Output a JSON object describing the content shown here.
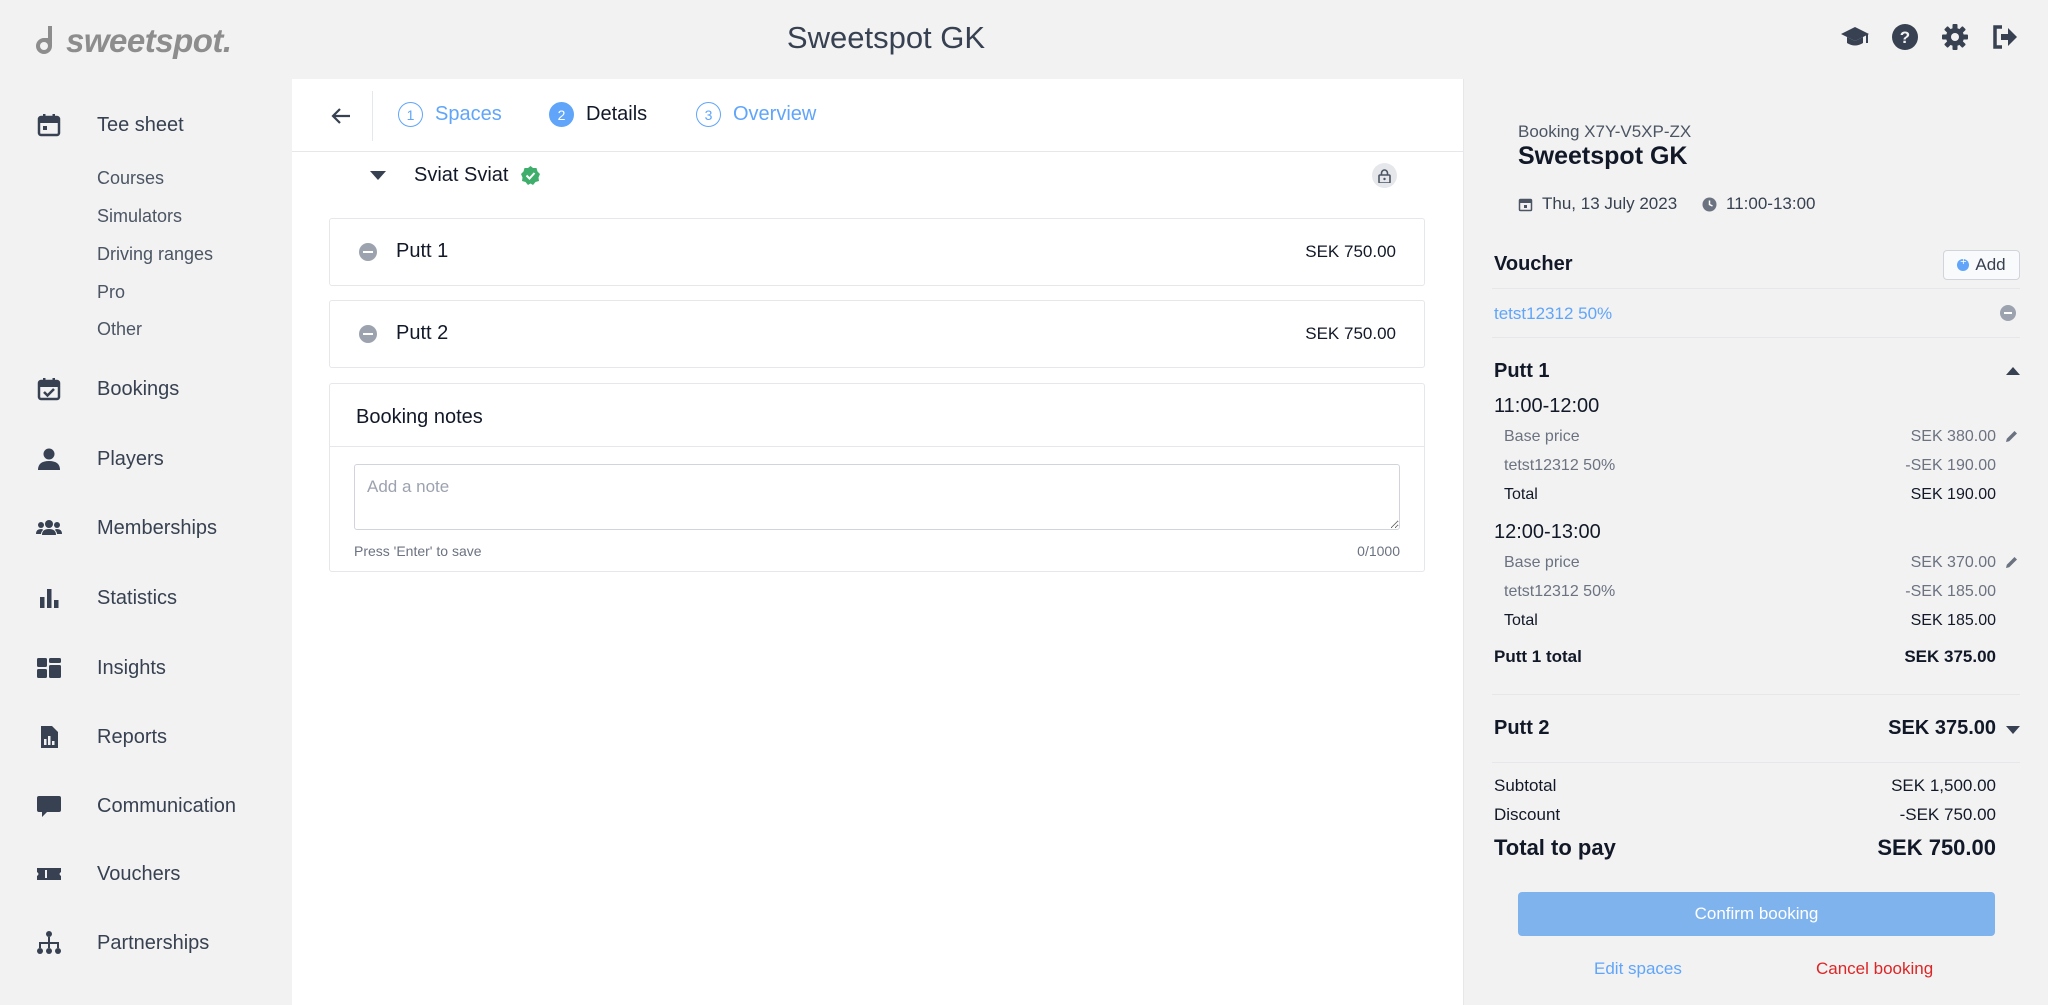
{
  "header": {
    "logo_text": "sweetspot.",
    "title": "Sweetspot GK",
    "icons": [
      "graduation-cap-icon",
      "help-icon",
      "settings-icon",
      "logout-icon"
    ]
  },
  "sidebar": {
    "tee_sheet": "Tee sheet",
    "tee_sheet_sub": [
      "Courses",
      "Simulators",
      "Driving ranges",
      "Pro",
      "Other"
    ],
    "items": [
      "Bookings",
      "Players",
      "Memberships",
      "Statistics",
      "Insights",
      "Reports",
      "Communication",
      "Vouchers",
      "Partnerships"
    ]
  },
  "steps": [
    {
      "num": "1",
      "label": "Spaces"
    },
    {
      "num": "2",
      "label": "Details"
    },
    {
      "num": "3",
      "label": "Overview"
    }
  ],
  "player": {
    "name": "Sviat Sviat"
  },
  "spaces": [
    {
      "name": "Putt 1",
      "price": "SEK 750.00"
    },
    {
      "name": "Putt 2",
      "price": "SEK 750.00"
    }
  ],
  "notes": {
    "title": "Booking notes",
    "placeholder": "Add a note",
    "hint": "Press 'Enter' to save",
    "count": "0/1000"
  },
  "summary": {
    "booking_id": "Booking X7Y-V5XP-ZX",
    "venue": "Sweetspot GK",
    "date": "Thu, 13 July 2023",
    "time": "11:00-13:00",
    "voucher_title": "Voucher",
    "add_label": "Add",
    "voucher_code": "tetst12312 50%",
    "putt1": {
      "title": "Putt 1",
      "slots": [
        {
          "time": "11:00-12:00",
          "base_label": "Base price",
          "base": "SEK 380.00",
          "disc_label": "tetst12312 50%",
          "disc": "-SEK 190.00",
          "total_label": "Total",
          "total": "SEK 190.00"
        },
        {
          "time": "12:00-13:00",
          "base_label": "Base price",
          "base": "SEK 370.00",
          "disc_label": "tetst12312 50%",
          "disc": "-SEK 185.00",
          "total_label": "Total",
          "total": "SEK 185.00"
        }
      ],
      "total_label": "Putt 1 total",
      "total": "SEK 375.00"
    },
    "putt2": {
      "title": "Putt 2",
      "total": "SEK 375.00"
    },
    "subtotal_label": "Subtotal",
    "subtotal": "SEK 1,500.00",
    "discount_label": "Discount",
    "discount": "-SEK 750.00",
    "total_label": "Total to pay",
    "total": "SEK 750.00",
    "confirm": "Confirm booking",
    "edit": "Edit spaces",
    "cancel": "Cancel booking"
  },
  "colors": {
    "accent": "#60a5fa",
    "confirm": "#7fb3ee",
    "danger": "#dc2626",
    "verified": "#3fae6c"
  }
}
